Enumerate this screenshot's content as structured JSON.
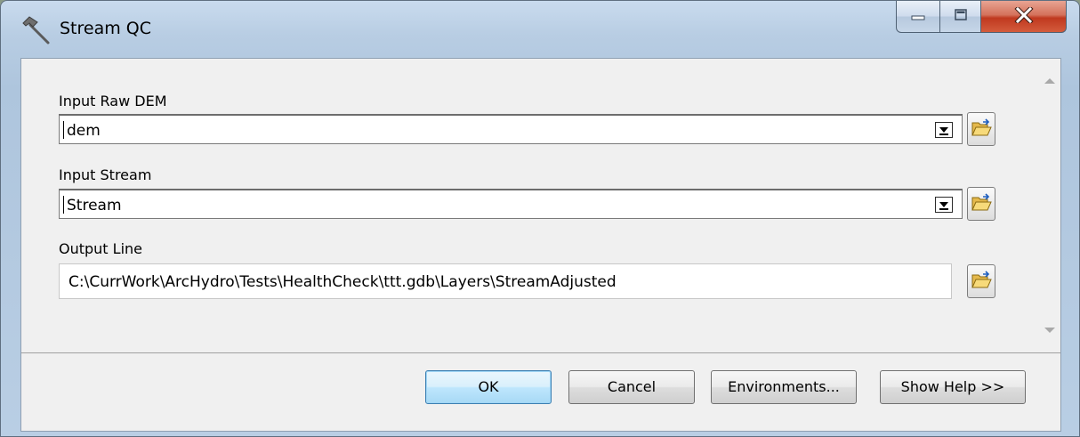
{
  "window": {
    "title": "Stream QC",
    "title_icon": "hammer-icon",
    "caption_buttons": [
      "minimize-icon",
      "maximize-icon",
      "close-icon"
    ]
  },
  "params": {
    "raw_dem": {
      "label": "Input Raw DEM",
      "value": "dem"
    },
    "stream": {
      "label": "Input Stream",
      "value": "Stream"
    },
    "output_line": {
      "label": "Output Line",
      "value": "C:\\CurrWork\\ArcHydro\\Tests\\HealthCheck\\ttt.gdb\\Layers\\StreamAdjusted"
    },
    "browse_icon": "open-folder-icon"
  },
  "buttons": {
    "ok": "OK",
    "cancel": "Cancel",
    "environments": "Environments...",
    "show_help": "Show Help >>"
  },
  "colors": {
    "title_bar": "#b9cee4",
    "close_button": "#c0391f",
    "default_button_border": "#3c7fb1",
    "dialog_background": "#f0f0f0"
  }
}
